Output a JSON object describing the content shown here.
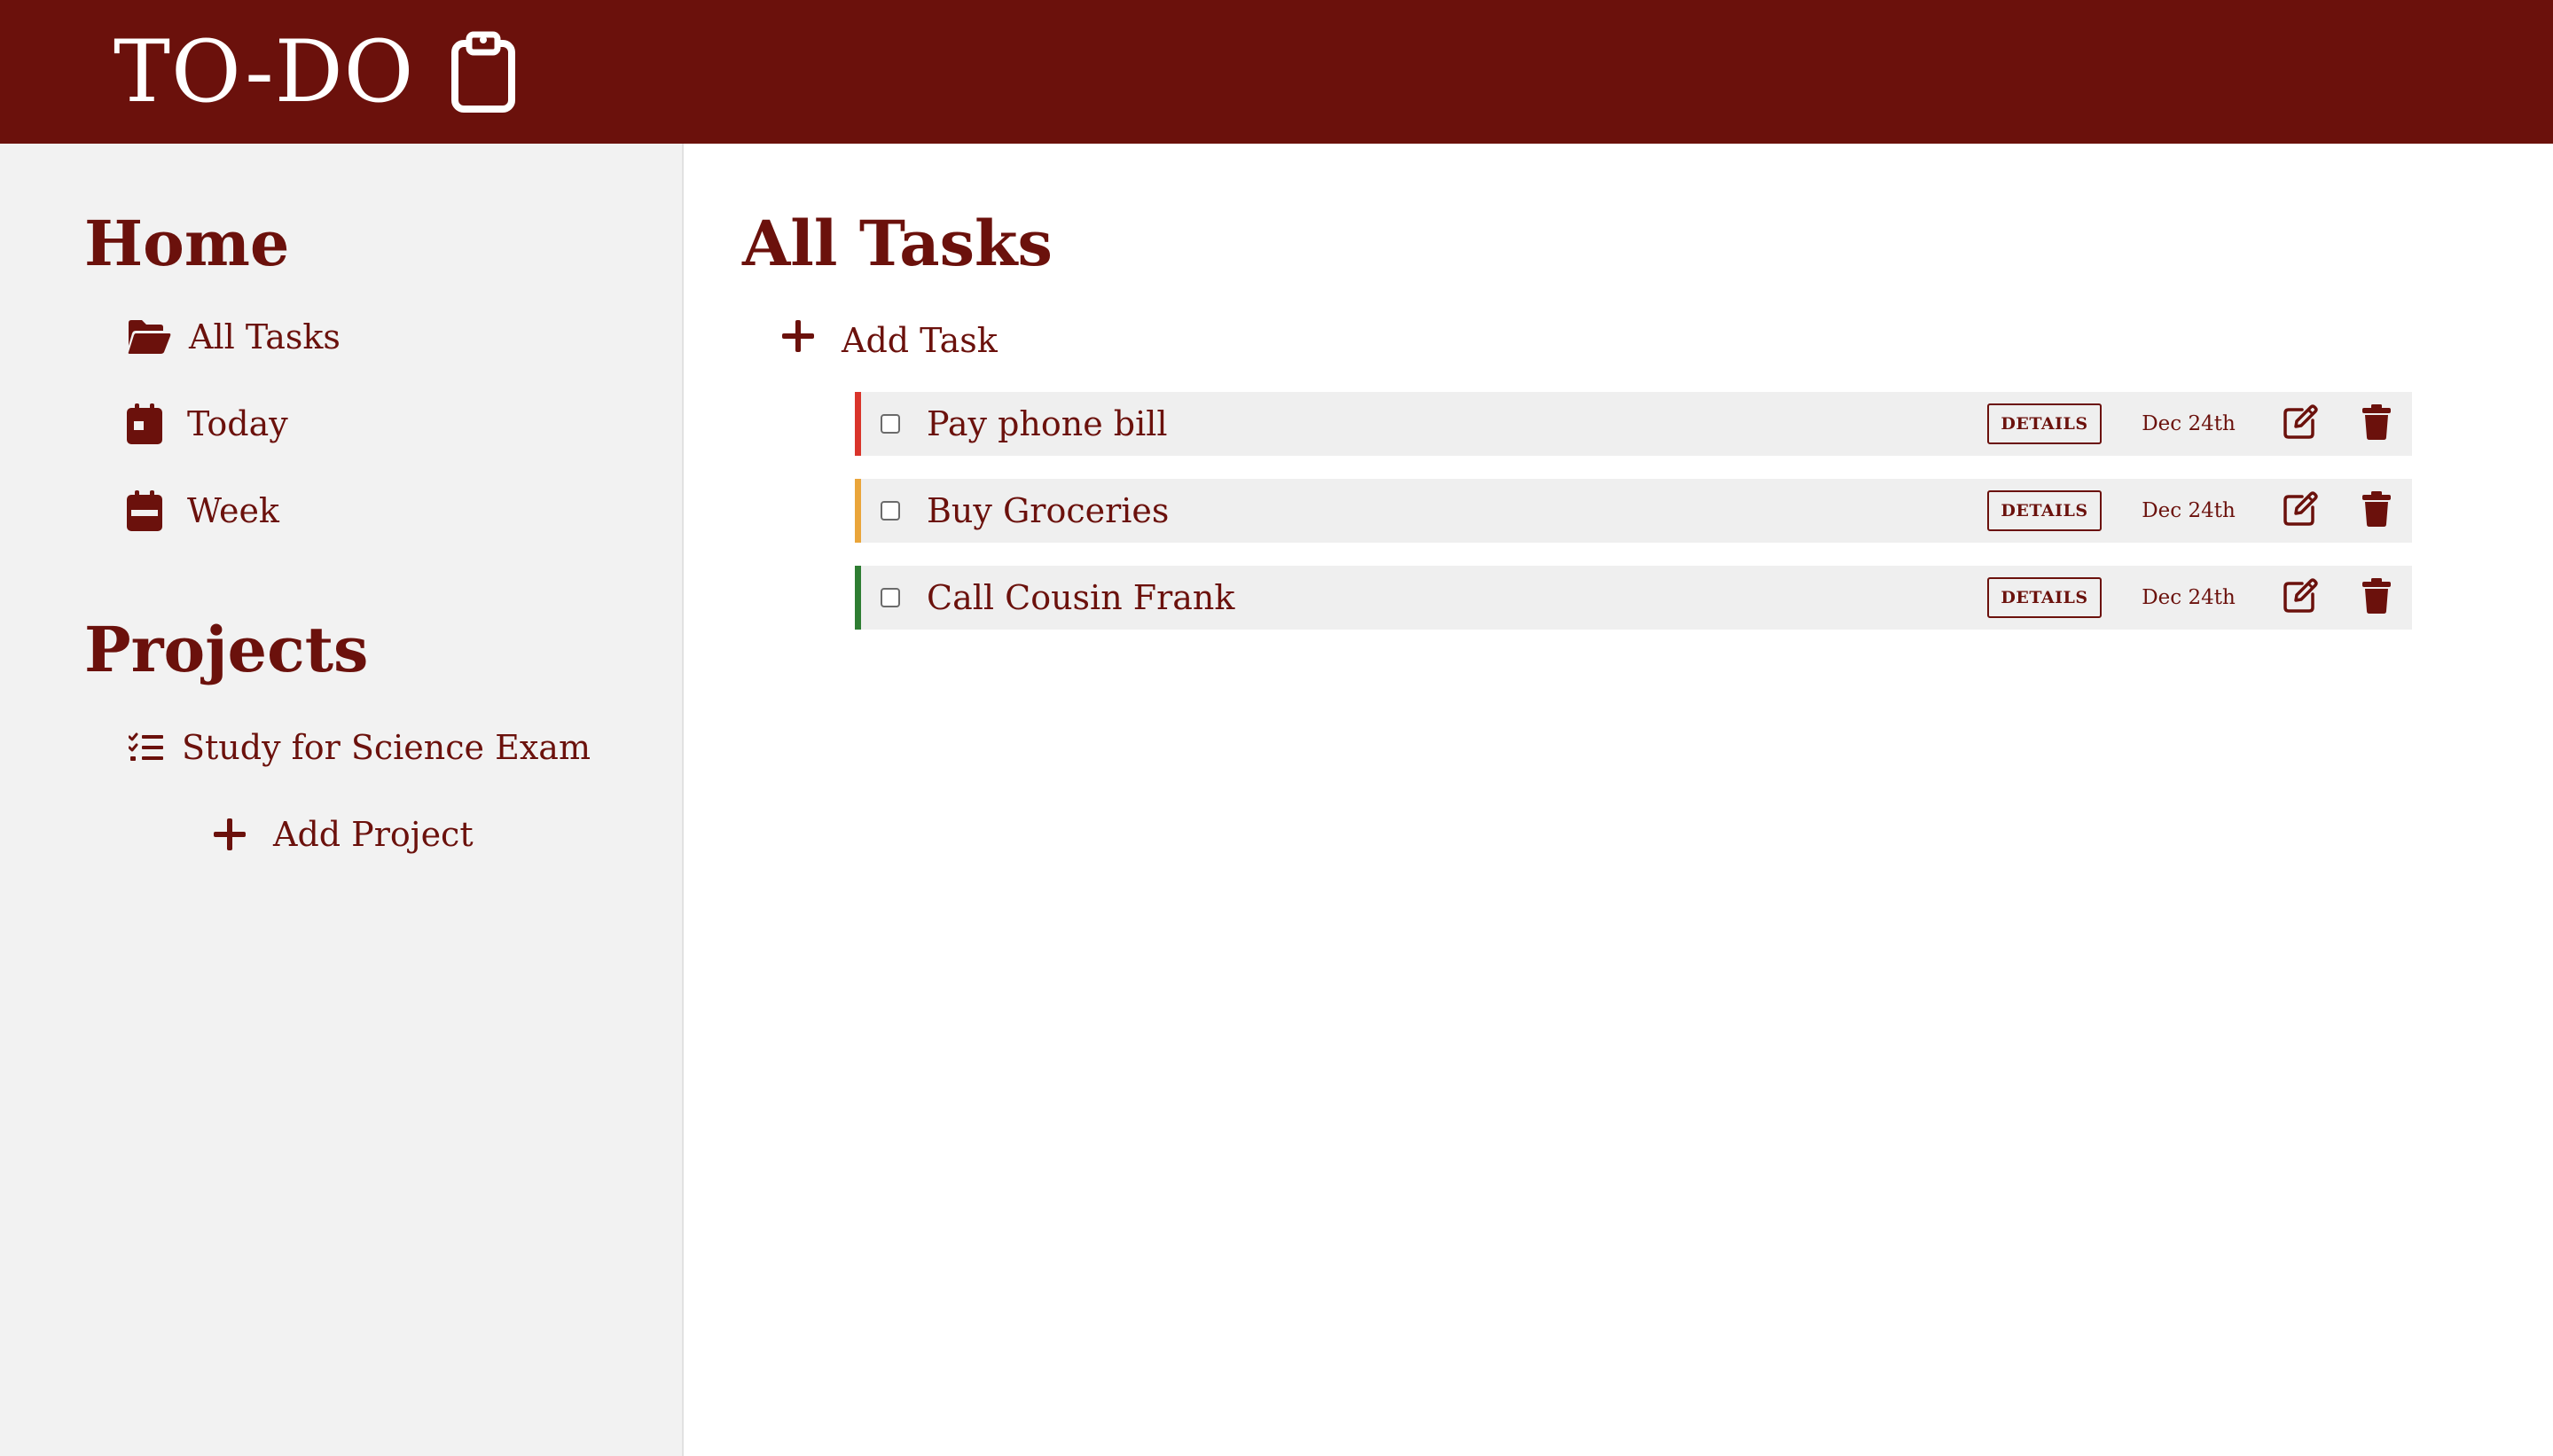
{
  "header": {
    "title": "TO-DO",
    "icon": "clipboard-icon"
  },
  "sidebar": {
    "home_heading": "Home",
    "home_items": [
      {
        "label": "All Tasks",
        "icon": "folder-open-icon"
      },
      {
        "label": "Today",
        "icon": "calendar-day-icon"
      },
      {
        "label": "Week",
        "icon": "calendar-week-icon"
      }
    ],
    "projects_heading": "Projects",
    "projects": [
      {
        "label": "Study for Science Exam",
        "icon": "task-list-icon"
      }
    ],
    "add_project_label": "Add Project"
  },
  "main": {
    "title": "All Tasks",
    "add_task_label": "Add Task",
    "details_label": "DETAILS",
    "tasks": [
      {
        "title": "Pay phone bill",
        "date": "Dec 24th",
        "priority_color": "#d9342b",
        "checked": false
      },
      {
        "title": "Buy Groceries",
        "date": "Dec 24th",
        "priority_color": "#eaa53a",
        "checked": false
      },
      {
        "title": "Call Cousin Frank",
        "date": "Dec 24th",
        "priority_color": "#2e7d32",
        "checked": false
      }
    ]
  },
  "colors": {
    "brand": "#6b110c",
    "sidebar_bg": "#f2f2f2",
    "task_bg": "#efefef"
  }
}
